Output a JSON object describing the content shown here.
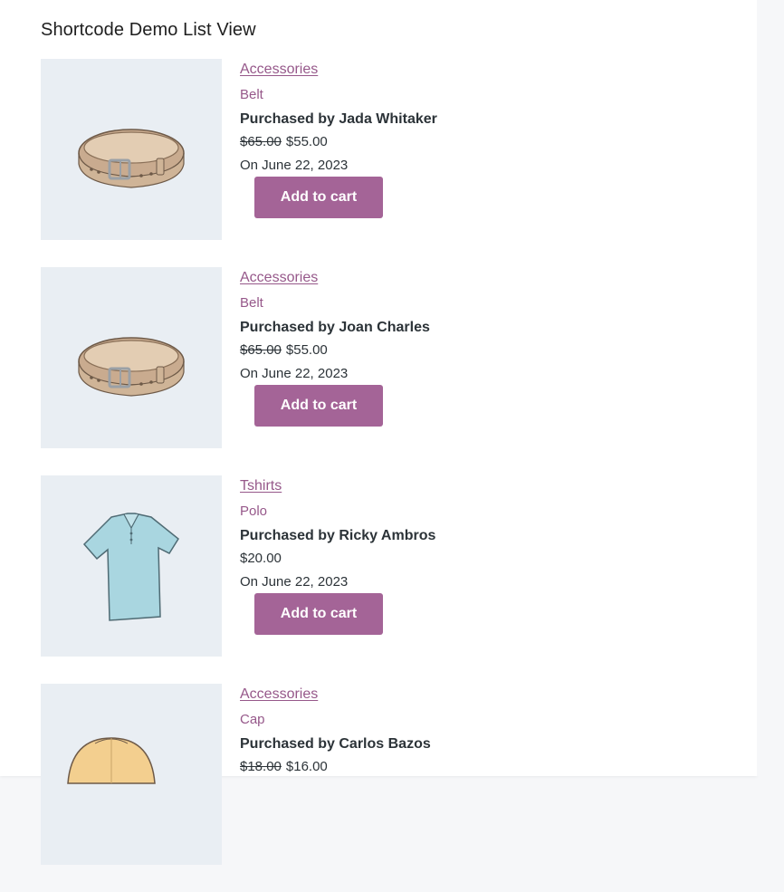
{
  "page": {
    "title": "Shortcode Demo List View"
  },
  "products": [
    {
      "category": "Accessories",
      "name": "Belt",
      "buyer": "Purchased by Jada Whitaker",
      "regular_price": "$65.00",
      "sale_price": "$55.00",
      "date": "On June 22, 2023",
      "button": "Add to cart",
      "image_icon": "belt-icon"
    },
    {
      "category": "Accessories",
      "name": "Belt",
      "buyer": "Purchased by Joan Charles",
      "regular_price": "$65.00",
      "sale_price": "$55.00",
      "date": "On June 22, 2023",
      "button": "Add to cart",
      "image_icon": "belt-icon"
    },
    {
      "category": "Tshirts",
      "name": "Polo",
      "buyer": "Purchased by Ricky Ambros",
      "regular_price": "",
      "sale_price": "$20.00",
      "date": "On June 22, 2023",
      "button": "Add to cart",
      "image_icon": "polo-shirt-icon"
    },
    {
      "category": "Accessories",
      "name": "Cap",
      "buyer": "Purchased by Carlos Bazos",
      "regular_price": "$18.00",
      "sale_price": "$16.00",
      "date": "",
      "button": "",
      "image_icon": "cap-icon"
    }
  ],
  "colors": {
    "accent": "#96588a",
    "button": "#a46497",
    "thumb_bg": "#e9eef3"
  }
}
